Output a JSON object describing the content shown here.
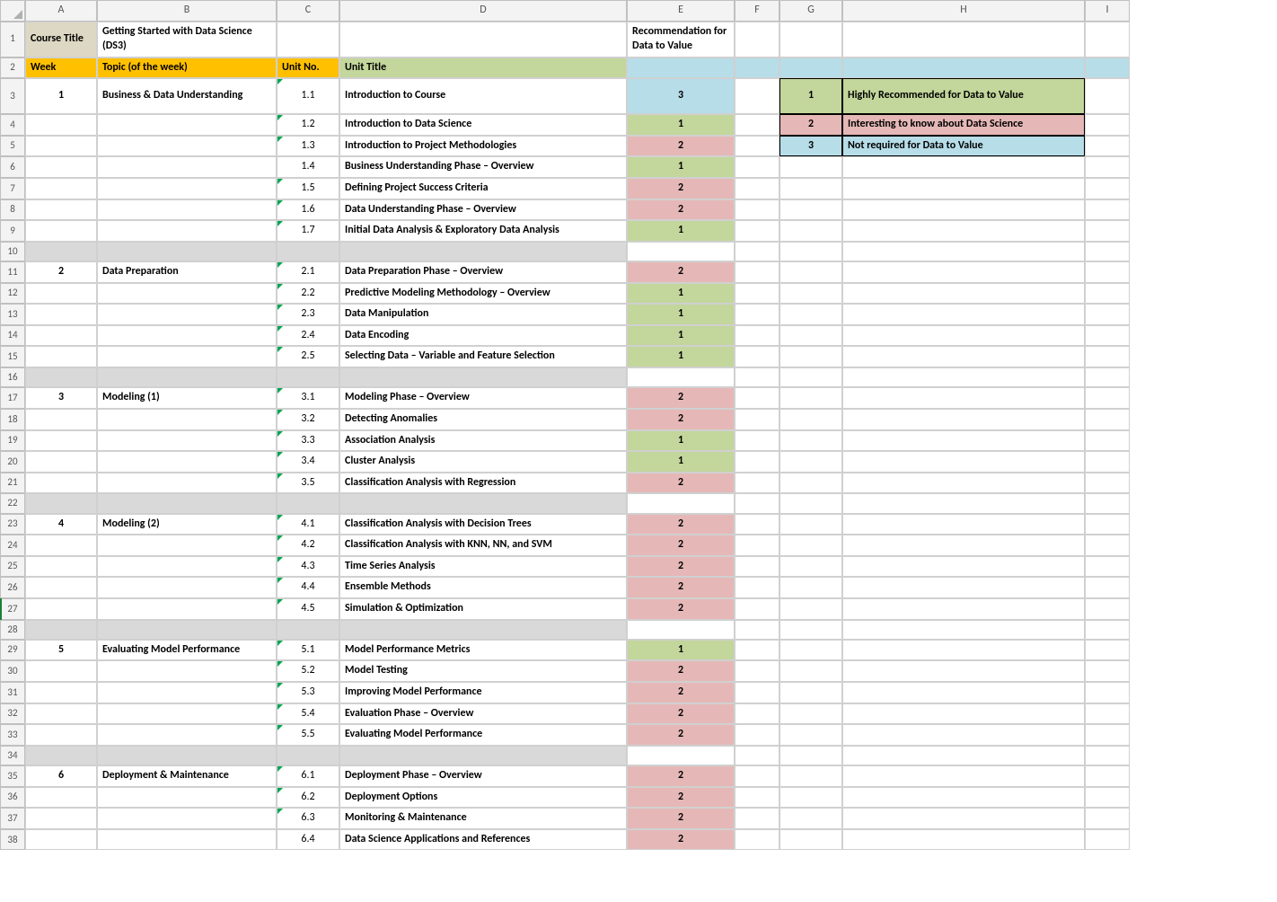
{
  "columns": [
    "A",
    "B",
    "C",
    "D",
    "E",
    "F",
    "G",
    "H",
    "I"
  ],
  "header_row1": {
    "A": "Course Title",
    "B": "Getting Started with Data Science (DS3)",
    "E": "Recommendation for Data to Value"
  },
  "header_row2": {
    "A": "Week",
    "B": "Topic (of the week)",
    "C": "Unit No.",
    "D": "Unit Title"
  },
  "legend": [
    {
      "num": "1",
      "text": "Highly Recommended for Data to Value",
      "cls": "rec-1"
    },
    {
      "num": "2",
      "text": "Interesting to know about Data Science",
      "cls": "rec-2"
    },
    {
      "num": "3",
      "text": "Not required for Data to Value",
      "cls": "rec-3"
    }
  ],
  "rows": [
    {
      "r": 3,
      "week": "1",
      "topic": "Business & Data Understanding",
      "unit": "1.1",
      "title": "Introduction to Course",
      "rec": "3",
      "reccls": "rec-3",
      "tall": true,
      "legend": 0,
      "note": true
    },
    {
      "r": 4,
      "unit": "1.2",
      "title": "Introduction to Data Science",
      "rec": "1",
      "reccls": "rec-1",
      "legend": 1,
      "note": true
    },
    {
      "r": 5,
      "unit": "1.3",
      "title": "Introduction to Project Methodologies",
      "rec": "2",
      "reccls": "rec-2",
      "legend": 2,
      "note": true
    },
    {
      "r": 6,
      "unit": "1.4",
      "title": "Business Understanding Phase – Overview",
      "rec": "1",
      "reccls": "rec-1"
    },
    {
      "r": 7,
      "unit": "1.5",
      "title": "Defining Project Success Criteria",
      "rec": "2",
      "reccls": "rec-2",
      "note": true
    },
    {
      "r": 8,
      "unit": "1.6",
      "title": "Data Understanding Phase – Overview",
      "rec": "2",
      "reccls": "rec-2",
      "note": true
    },
    {
      "r": 9,
      "unit": "1.7",
      "title": "Initial Data Analysis & Exploratory Data Analysis",
      "rec": "1",
      "reccls": "rec-1",
      "note": true
    },
    {
      "r": 10,
      "spacer": true
    },
    {
      "r": 11,
      "week": "2",
      "topic": "Data Preparation",
      "unit": "2.1",
      "title": "Data Preparation Phase – Overview",
      "rec": "2",
      "reccls": "rec-2",
      "note": true
    },
    {
      "r": 12,
      "unit": "2.2",
      "title": "Predictive Modeling Methodology – Overview",
      "rec": "1",
      "reccls": "rec-1",
      "note": true
    },
    {
      "r": 13,
      "unit": "2.3",
      "title": "Data Manipulation",
      "rec": "1",
      "reccls": "rec-1",
      "note": true
    },
    {
      "r": 14,
      "unit": "2.4",
      "title": "Data Encoding",
      "rec": "1",
      "reccls": "rec-1",
      "note": true
    },
    {
      "r": 15,
      "unit": "2.5",
      "title": "Selecting Data – Variable and Feature Selection",
      "rec": "1",
      "reccls": "rec-1",
      "note": true
    },
    {
      "r": 16,
      "spacer": true
    },
    {
      "r": 17,
      "week": "3",
      "topic": "Modeling (1)",
      "unit": "3.1",
      "title": "Modeling Phase – Overview",
      "rec": "2",
      "reccls": "rec-2",
      "note": true
    },
    {
      "r": 18,
      "unit": "3.2",
      "title": "Detecting Anomalies",
      "rec": "2",
      "reccls": "rec-2",
      "note": true
    },
    {
      "r": 19,
      "unit": "3.3",
      "title": "Association Analysis",
      "rec": "1",
      "reccls": "rec-1",
      "note": true
    },
    {
      "r": 20,
      "unit": "3.4",
      "title": "Cluster Analysis",
      "rec": "1",
      "reccls": "rec-1",
      "note": true
    },
    {
      "r": 21,
      "unit": "3.5",
      "title": "Classification Analysis with Regression",
      "rec": "2",
      "reccls": "rec-2",
      "note": true
    },
    {
      "r": 22,
      "spacer": true
    },
    {
      "r": 23,
      "week": "4",
      "topic": "Modeling (2)",
      "unit": "4.1",
      "title": "Classification Analysis with Decision Trees",
      "rec": "2",
      "reccls": "rec-2",
      "note": true
    },
    {
      "r": 24,
      "unit": "4.2",
      "title": "Classification Analysis with KNN, NN, and SVM",
      "rec": "2",
      "reccls": "rec-2",
      "note": true
    },
    {
      "r": 25,
      "unit": "4.3",
      "title": "Time Series Analysis",
      "rec": "2",
      "reccls": "rec-2",
      "note": true
    },
    {
      "r": 26,
      "unit": "4.4",
      "title": "Ensemble Methods",
      "rec": "2",
      "reccls": "rec-2",
      "note": true
    },
    {
      "r": 27,
      "unit": "4.5",
      "title": "Simulation & Optimization",
      "rec": "2",
      "reccls": "rec-2",
      "note": true,
      "sel": true
    },
    {
      "r": 28,
      "spacer": true
    },
    {
      "r": 29,
      "week": "5",
      "topic": "Evaluating Model Performance",
      "unit": "5.1",
      "title": "Model Performance Metrics",
      "rec": "1",
      "reccls": "rec-1",
      "note": true
    },
    {
      "r": 30,
      "unit": "5.2",
      "title": "Model Testing",
      "rec": "2",
      "reccls": "rec-2",
      "note": true
    },
    {
      "r": 31,
      "unit": "5.3",
      "title": "Improving Model Performance",
      "rec": "2",
      "reccls": "rec-2",
      "note": true
    },
    {
      "r": 32,
      "unit": "5.4",
      "title": "Evaluation Phase – Overview",
      "rec": "2",
      "reccls": "rec-2",
      "note": true
    },
    {
      "r": 33,
      "unit": "5.5",
      "title": "Evaluating Model Performance",
      "rec": "2",
      "reccls": "rec-2",
      "note": true
    },
    {
      "r": 34,
      "spacer": true
    },
    {
      "r": 35,
      "week": "6",
      "topic": "Deployment & Maintenance",
      "unit": "6.1",
      "title": "Deployment Phase – Overview",
      "rec": "2",
      "reccls": "rec-2",
      "note": true
    },
    {
      "r": 36,
      "unit": "6.2",
      "title": "Deployment Options",
      "rec": "2",
      "reccls": "rec-2",
      "note": true
    },
    {
      "r": 37,
      "unit": "6.3",
      "title": "Monitoring & Maintenance",
      "rec": "2",
      "reccls": "rec-2",
      "note": true
    },
    {
      "r": 38,
      "unit": "6.4",
      "title": "Data Science Applications and References",
      "rec": "2",
      "reccls": "rec-2"
    }
  ]
}
